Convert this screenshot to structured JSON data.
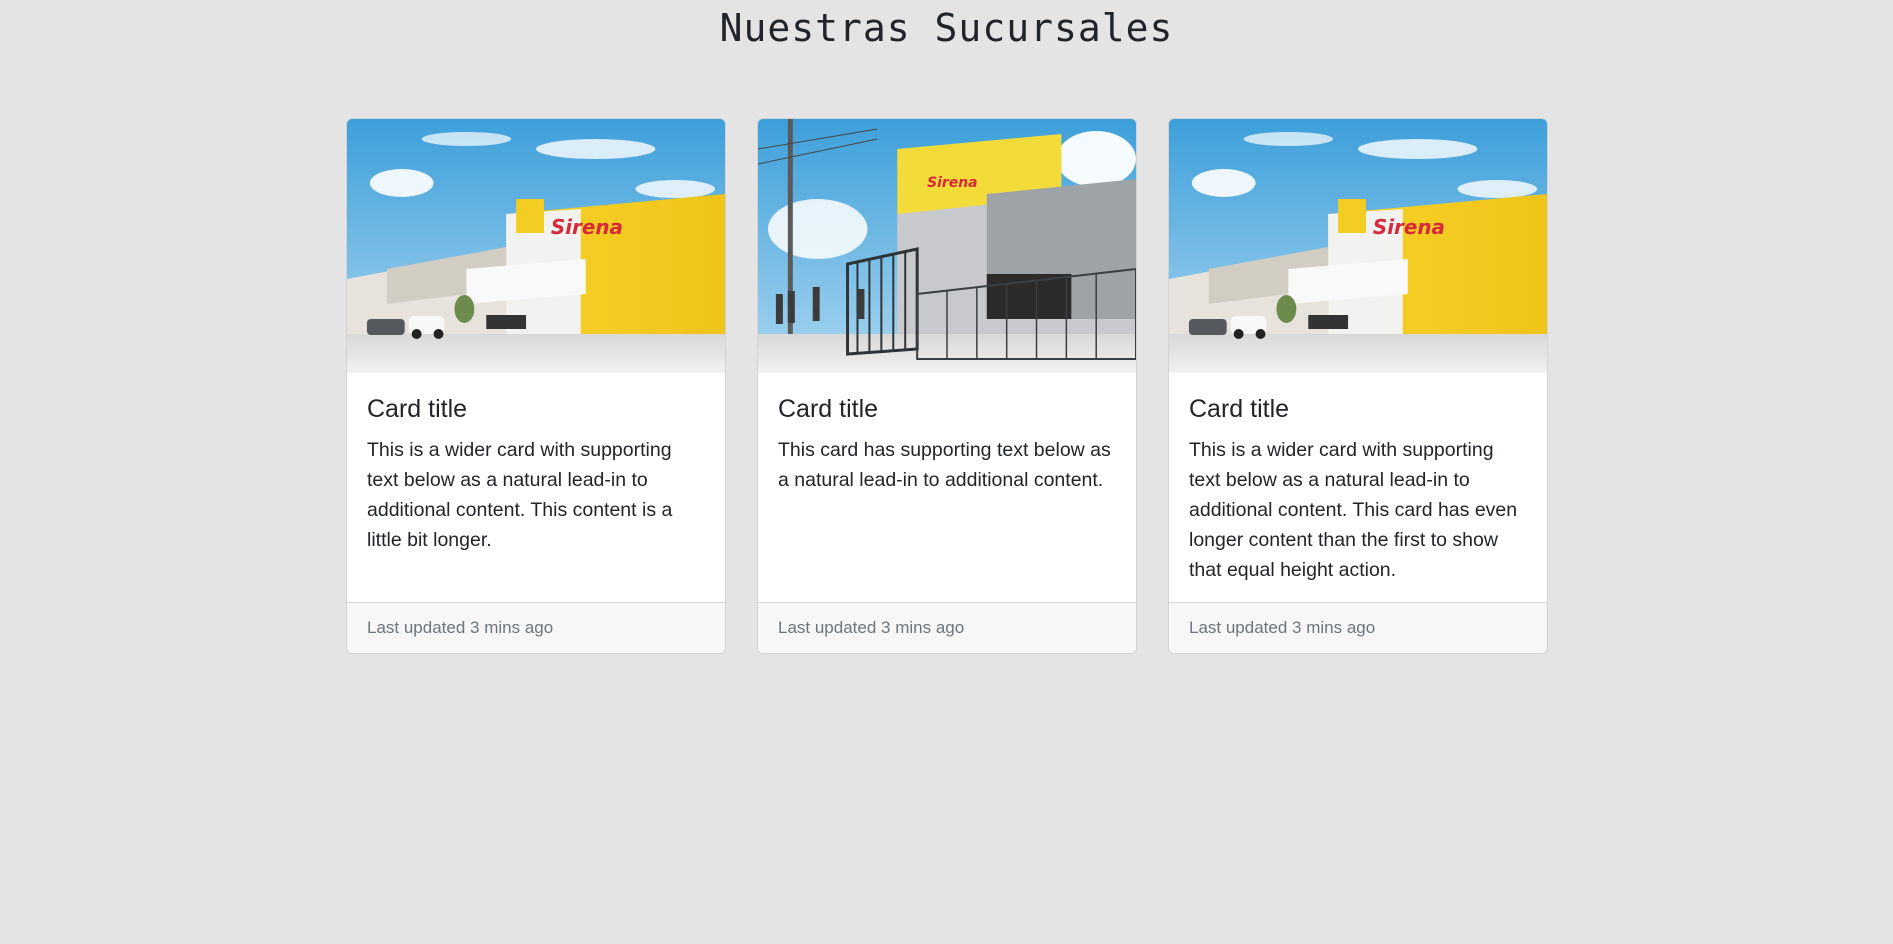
{
  "page": {
    "title": "Nuestras Sucursales"
  },
  "cards": [
    {
      "image_icon": "store-building-photo",
      "image_alt": "La Sirena",
      "title": "Card title",
      "text": "This is a wider card with supporting text below as a natural lead-in to additional content. This content is a little bit longer.",
      "footer": "Last updated 3 mins ago"
    },
    {
      "image_icon": "store-entrance-photo",
      "image_alt": "La Sirena",
      "title": "Card title",
      "text": "This card has supporting text below as a natural lead-in to additional content.",
      "footer": "Last updated 3 mins ago"
    },
    {
      "image_icon": "store-building-photo",
      "image_alt": "La Sirena",
      "title": "Card title",
      "text": "This is a wider card with supporting text below as a natural lead-in to additional content. This card has even longer content than the first to show that equal height action.",
      "footer": "Last updated 3 mins ago"
    }
  ],
  "colors": {
    "background": "#e4e4e4",
    "brand_yellow": "#f5cc1f",
    "sky_blue": "#58aee0"
  }
}
